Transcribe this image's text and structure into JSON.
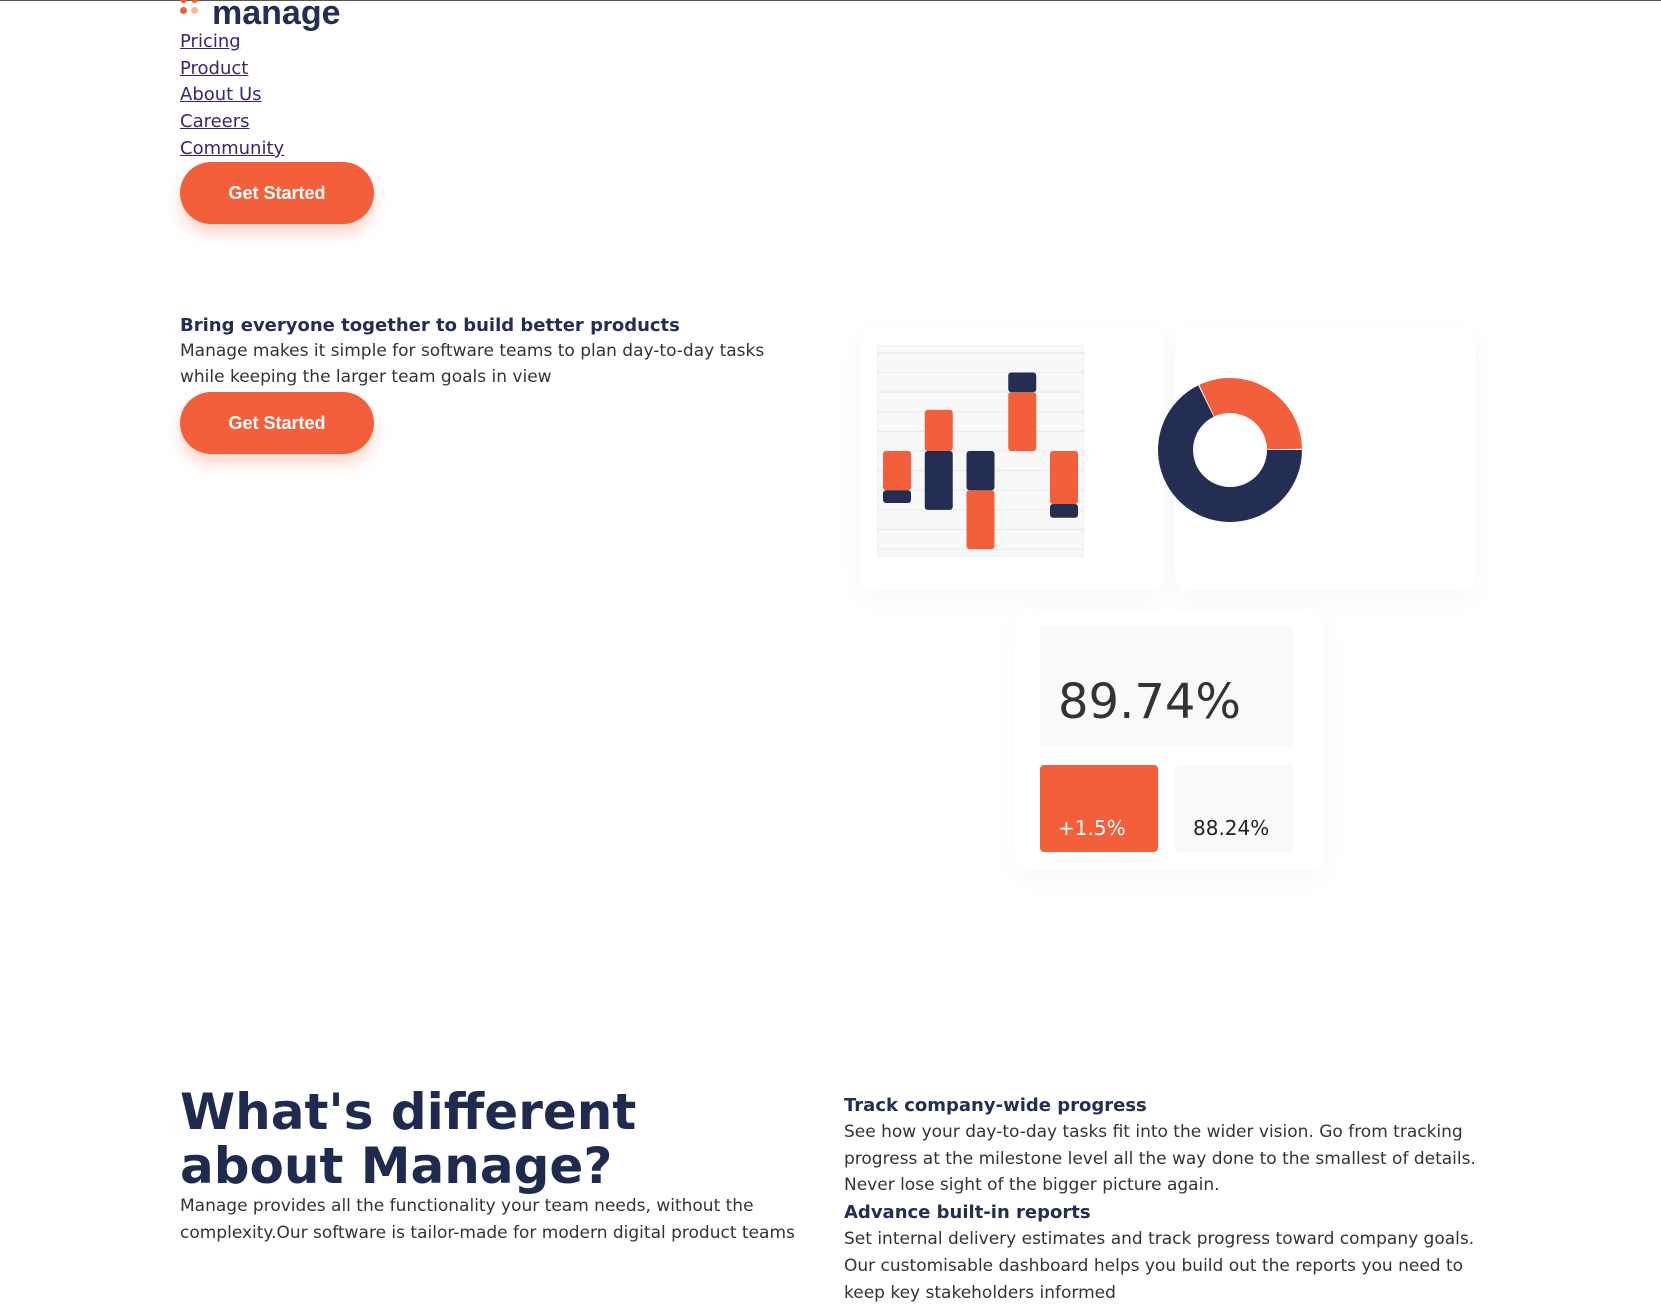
{
  "brand": {
    "name": "manage",
    "accent": "#f25f3a",
    "navy": "#242d52"
  },
  "nav": {
    "links": [
      "Pricing",
      "Product",
      "About Us",
      "Careers",
      "Community"
    ],
    "cta": "Get Started"
  },
  "hero": {
    "title": "Bring everyone together to build better products",
    "text": "Manage makes it simple for software teams to plan day-to-day tasks while keeping the larger team goals in view",
    "cta": "Get Started"
  },
  "stats": {
    "main": "89.74%",
    "change": "+1.5%",
    "previous": "88.24%"
  },
  "chart_data": [
    {
      "type": "bar",
      "title": "",
      "ylim": [
        -5.4,
        5.4
      ],
      "grid": true,
      "bars": [
        [
          {
            "series": "orange",
            "from": 0,
            "to": -2
          },
          {
            "series": "navy",
            "from": -2,
            "to": -2.65
          }
        ],
        [
          {
            "series": "orange",
            "from": 0,
            "to": 2.1
          },
          {
            "series": "navy",
            "from": 0,
            "to": -3
          }
        ],
        [
          {
            "series": "navy",
            "from": 0,
            "to": -2
          },
          {
            "series": "orange",
            "from": -2,
            "to": -5
          }
        ],
        [
          {
            "series": "navy",
            "from": 4,
            "to": 3
          },
          {
            "series": "orange",
            "from": 3,
            "to": 0
          }
        ],
        [
          {
            "series": "orange",
            "from": 0,
            "to": -2.7
          },
          {
            "series": "navy",
            "from": -2.7,
            "to": -3.4
          }
        ]
      ]
    },
    {
      "type": "pie",
      "donut": true,
      "slices": [
        {
          "name": "orange",
          "value": 32
        },
        {
          "name": "navy",
          "value": 68
        }
      ]
    }
  ],
  "difference": {
    "title": "What's different about Manage?",
    "text": "Manage provides all the functionality your team needs, without the complexity.Our software is tailor-made for modern digital product teams",
    "features": [
      {
        "title": "Track company-wide progress",
        "text": "See how your day-to-day tasks fit into the wider vision. Go from tracking progress at the milestone level all the way done to the smallest of details. Never lose sight of the bigger picture again."
      },
      {
        "title": "Advance built-in reports",
        "text": "Set internal delivery estimates and track progress toward company goals. Our customisable dashboard helps you build out the reports you need to keep key stakeholders informed"
      }
    ]
  }
}
